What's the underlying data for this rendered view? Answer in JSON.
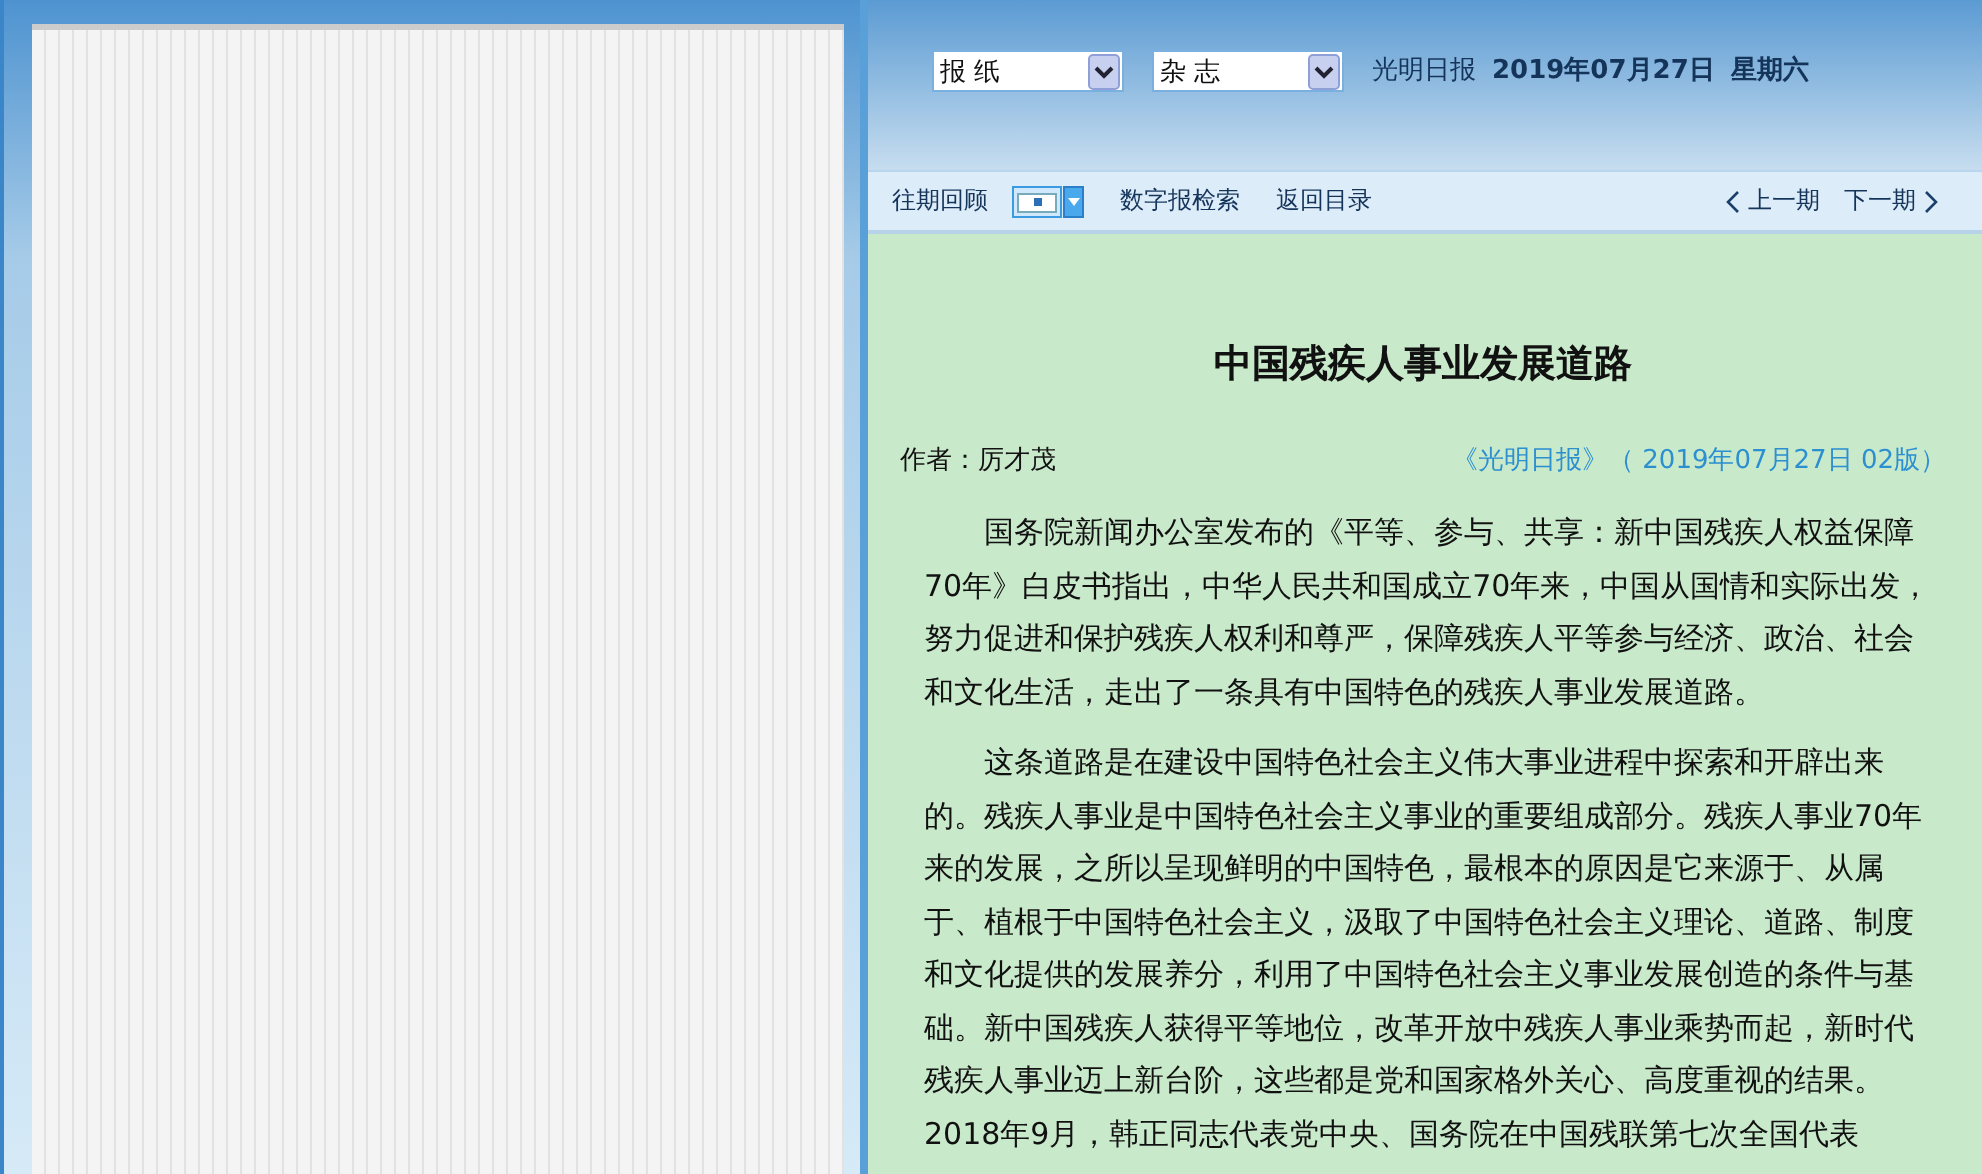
{
  "selects": [
    {
      "value": "报 纸"
    },
    {
      "value": "杂 志"
    }
  ],
  "masthead": {
    "paper": "光明日报",
    "date": "2019年07月27日",
    "weekday": "星期六"
  },
  "toolbar": {
    "items": [
      {
        "label": "往期回顾",
        "kind": "link"
      },
      {
        "kind": "calendar"
      },
      {
        "label": "数字报检索",
        "kind": "link"
      },
      {
        "label": "返回目录",
        "kind": "link"
      }
    ],
    "prev": "上一期",
    "next": "下一期"
  },
  "article": {
    "title": "中国残疾人事业发展道路",
    "author": "作者：厉才茂",
    "source": "《光明日报》（ 2019年07月27日 02版）",
    "paragraphs": [
      "国务院新闻办公室发布的《平等、参与、共享：新中国残疾人权益保障70年》白皮书指出，中华人民共和国成立70年来，中国从国情和实际出发，努力促进和保护残疾人权利和尊严，保障残疾人平等参与经济、政治、社会和文化生活，走出了一条具有中国特色的残疾人事业发展道路。",
      "这条道路是在建设中国特色社会主义伟大事业进程中探索和开辟出来的。残疾人事业是中国特色社会主义事业的重要组成部分。残疾人事业70年来的发展，之所以呈现鲜明的中国特色，最根本的原因是它来源于、从属于、植根于中国特色社会主义，汲取了中国特色社会主义理论、道路、制度和文化提供的发展养分，利用了中国特色社会主义事业发展创造的条件与基础。新中国残疾人获得平等地位，改革开放中残疾人事业乘势而起，新时代残疾人事业迈上新台阶，这些都是党和国家格外关心、高度重视的结果。2018年9月，韩正同志代表党中央、国务院在中国残联第七次全国代表"
    ]
  }
}
